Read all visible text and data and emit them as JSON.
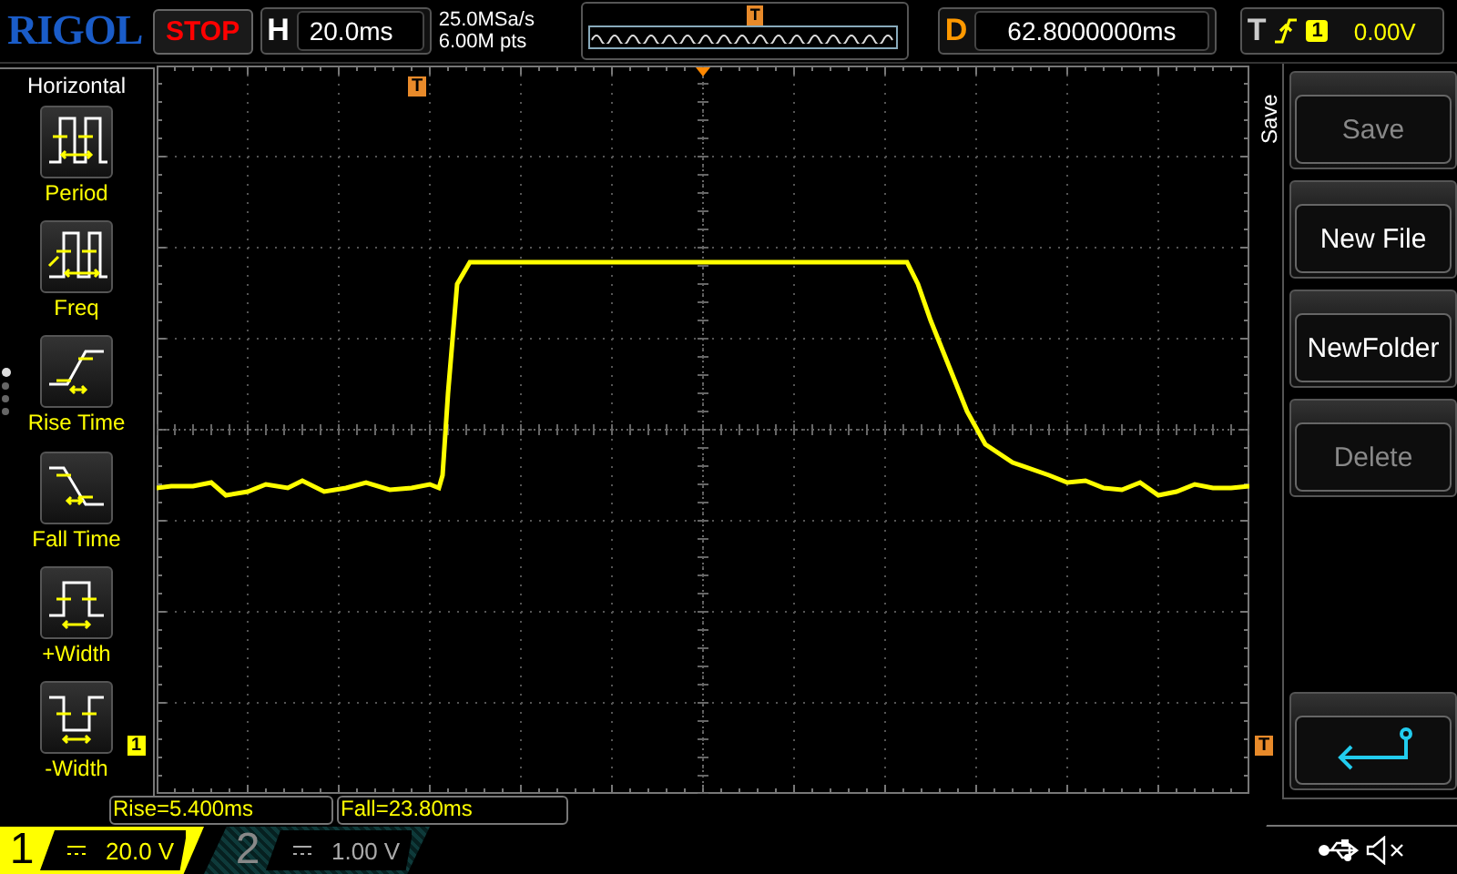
{
  "brand": "RIGOL",
  "run_state": {
    "label": "STOP",
    "running": false
  },
  "timebase": {
    "label": "H",
    "value": "20.0ms"
  },
  "acquisition": {
    "sample_rate": "25.0MSa/s",
    "memory_depth": "6.00M pts",
    "overview_marker": "T"
  },
  "delay": {
    "label": "D",
    "value": "62.8000000ms"
  },
  "trigger": {
    "label": "T",
    "rising_edge": true,
    "source": "1",
    "level": "0.00V"
  },
  "left_menu": {
    "title": "Horizontal",
    "items": [
      {
        "label": "Period",
        "kind": "period"
      },
      {
        "label": "Freq",
        "kind": "freq"
      },
      {
        "label": "Rise Time",
        "kind": "rise"
      },
      {
        "label": "Fall Time",
        "kind": "fall"
      },
      {
        "label": "+Width",
        "kind": "pwidth"
      },
      {
        "label": "-Width",
        "kind": "nwidth"
      }
    ],
    "pages": [
      {
        "selected": true
      },
      {
        "selected": false
      },
      {
        "selected": false
      },
      {
        "selected": false
      }
    ]
  },
  "markers": {
    "trigger_position": "T",
    "channel_ref": "1",
    "trigger_level": "T"
  },
  "right_menu": {
    "title": "Save",
    "items": [
      {
        "kind": "button",
        "label": "Save",
        "disabled": true
      },
      {
        "kind": "button",
        "label": "New File",
        "disabled": false
      },
      {
        "kind": "button",
        "label": "NewFolder",
        "disabled": false
      },
      {
        "kind": "button",
        "label": "Delete",
        "disabled": true
      },
      {
        "kind": "back"
      }
    ]
  },
  "measurements": [
    "Rise=5.400ms",
    "Fall=23.80ms"
  ],
  "channels": [
    {
      "number": "1",
      "scale": "20.0 V",
      "active": true
    },
    {
      "number": "2",
      "scale": "1.00 V",
      "active": false
    }
  ],
  "status": {
    "muted": true
  }
}
